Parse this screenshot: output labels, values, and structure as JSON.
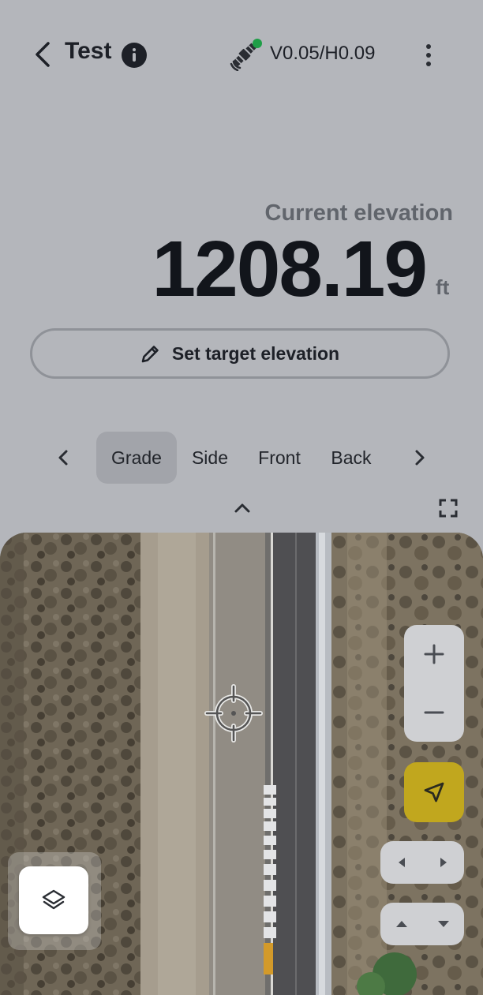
{
  "header": {
    "title": "Test",
    "back_icon": "chevron-left-icon",
    "info_icon": "info-icon",
    "gps_icon": "satellite-icon",
    "gps_status_color": "#1f9e47",
    "accuracy": "V0.05/H0.09",
    "menu_icon": "more-vertical-icon"
  },
  "elevation": {
    "label": "Current elevation",
    "value": "1208.19",
    "unit": "ft"
  },
  "target_button": {
    "label": "Set target elevation",
    "icon": "pencil-icon"
  },
  "views": {
    "tabs": [
      {
        "label": "Grade",
        "active": true
      },
      {
        "label": "Side",
        "active": false
      },
      {
        "label": "Front",
        "active": false
      },
      {
        "label": "Back",
        "active": false
      }
    ],
    "prev_icon": "chevron-left-icon",
    "next_icon": "chevron-right-icon",
    "collapse_icon": "chevron-up-icon",
    "fullscreen_icon": "fullscreen-icon"
  },
  "map": {
    "zoom_in_icon": "plus-icon",
    "zoom_out_icon": "minus-icon",
    "locate_icon": "navigation-arrow-icon",
    "locate_color": "#c1a71e",
    "layers_icon": "layers-icon"
  }
}
